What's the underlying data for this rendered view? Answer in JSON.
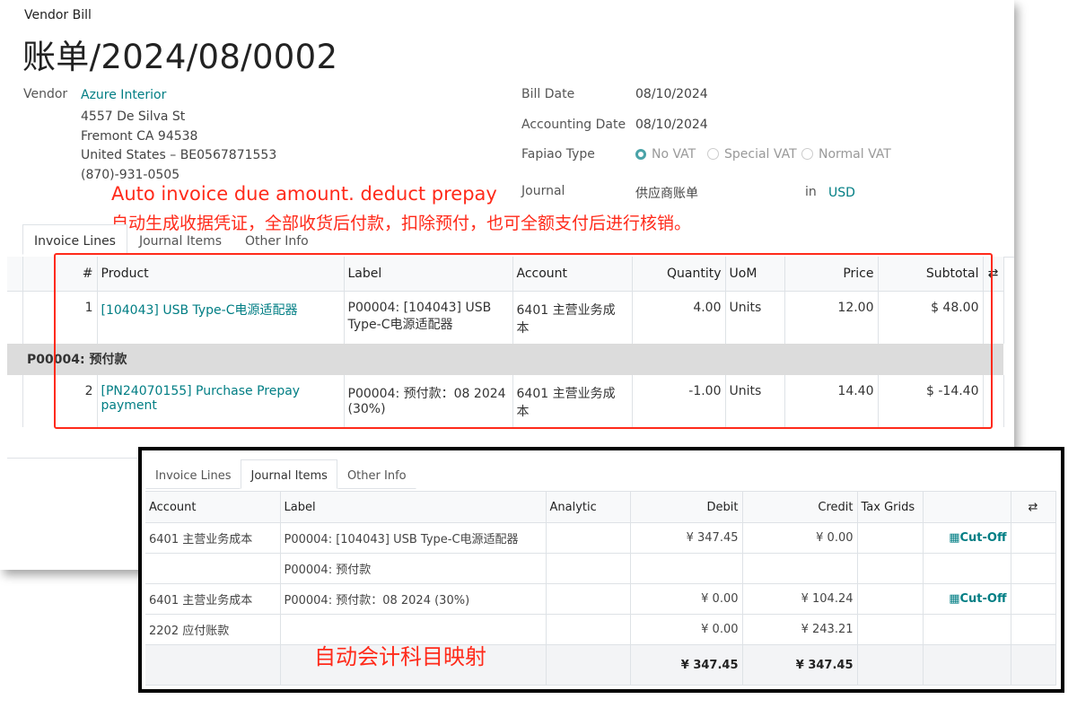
{
  "breadcrumb": "Vendor Bill",
  "title": "账单/2024/08/0002",
  "vendor": {
    "label": "Vendor",
    "name": "Azure Interior",
    "address": [
      "4557 De Silva St",
      "Fremont CA 94538",
      "United States – BE0567871553",
      "(870)-931-0505"
    ]
  },
  "fields": {
    "bill_date_label": "Bill Date",
    "bill_date": "08/10/2024",
    "accounting_date_label": "Accounting Date",
    "accounting_date": "08/10/2024",
    "fapiao_label": "Fapiao Type",
    "fapiao_options": [
      "No VAT",
      "Special VAT",
      "Normal VAT"
    ],
    "fapiao_selected": "No VAT",
    "journal_label": "Journal",
    "journal": "供应商账单",
    "in_label": "in",
    "currency": "USD"
  },
  "annotations": {
    "line1": "Auto invoice due amount. deduct prepay",
    "line2": "自动生成收据凭证，全部收货后付款，扣除预付，也可全额支付后进行核销。",
    "line3": "自动会计科目映射"
  },
  "tabs": [
    "Invoice Lines",
    "Journal Items",
    "Other Info"
  ],
  "invoice_lines": {
    "headers": {
      "num": "#",
      "product": "Product",
      "label": "Label",
      "account": "Account",
      "quantity": "Quantity",
      "uom": "UoM",
      "price": "Price",
      "subtotal": "Subtotal"
    },
    "row1": {
      "num": "1",
      "product": "[104043] USB Type-C电源适配器",
      "label": "P00004: [104043] USB Type-C电源适配器",
      "account": "6401 主营业务成本",
      "quantity": "4.00",
      "uom": "Units",
      "price": "12.00",
      "subtotal": "$ 48.00"
    },
    "section": "P00004: 预付款",
    "row2": {
      "num": "2",
      "product": "[PN24070155] Purchase Prepay payment",
      "label": "P00004: 预付款：08 2024 (30%)",
      "account": "6401 主营业务成本",
      "quantity": "-1.00",
      "uom": "Units",
      "price": "14.40",
      "subtotal": "$ -14.40"
    }
  },
  "journal_items": {
    "tabs": [
      "Invoice Lines",
      "Journal Items",
      "Other Info"
    ],
    "headers": {
      "account": "Account",
      "label": "Label",
      "analytic": "Analytic",
      "debit": "Debit",
      "credit": "Credit",
      "tax_grids": "Tax Grids"
    },
    "rows": [
      {
        "account": "6401 主营业务成本",
        "label": "P00004: [104043] USB Type-C电源适配器",
        "debit": "¥ 347.45",
        "credit": "¥ 0.00",
        "action": "Cut-Off"
      },
      {
        "account": "",
        "label": "P00004: 预付款",
        "debit": "",
        "credit": "",
        "action": ""
      },
      {
        "account": "6401 主营业务成本",
        "label": "P00004: 预付款：08 2024 (30%)",
        "debit": "¥ 0.00",
        "credit": "¥ 104.24",
        "action": "Cut-Off"
      },
      {
        "account": "2202 应付账款",
        "label": "",
        "debit": "¥ 0.00",
        "credit": "¥ 243.21",
        "action": ""
      }
    ],
    "total_debit": "¥ 347.45",
    "total_credit": "¥ 347.45"
  }
}
